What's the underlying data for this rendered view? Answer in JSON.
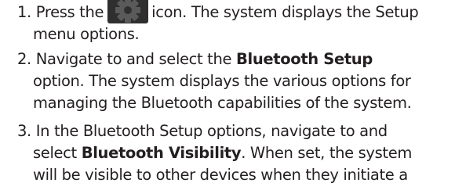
{
  "steps": [
    {
      "number": "1.",
      "lines": [
        {
          "before": "Press the",
          "icon": "gear-settings-icon",
          "after": "icon. The system displays the Setup"
        },
        {
          "text": "menu options."
        }
      ]
    },
    {
      "number": "2.",
      "lines": [
        {
          "before": "Navigate to and select the",
          "bold": "Bluetooth Setup",
          "after": ""
        },
        {
          "text": "option. The system displays the various options for"
        },
        {
          "text": "managing the Bluetooth capabilities of the system."
        }
      ]
    },
    {
      "number": "3.",
      "lines": [
        {
          "before": "In the Bluetooth Setup options, navigate to and"
        },
        {
          "before": "select",
          "bold": "Bluetooth Visibility",
          "after": ". When set, the system"
        },
        {
          "text": "will be visible to other devices when they initiate a"
        }
      ]
    }
  ],
  "colors": {
    "text": "#231f20",
    "icon_body": "#3a3a3a",
    "icon_bg": "#2f2f2f"
  }
}
